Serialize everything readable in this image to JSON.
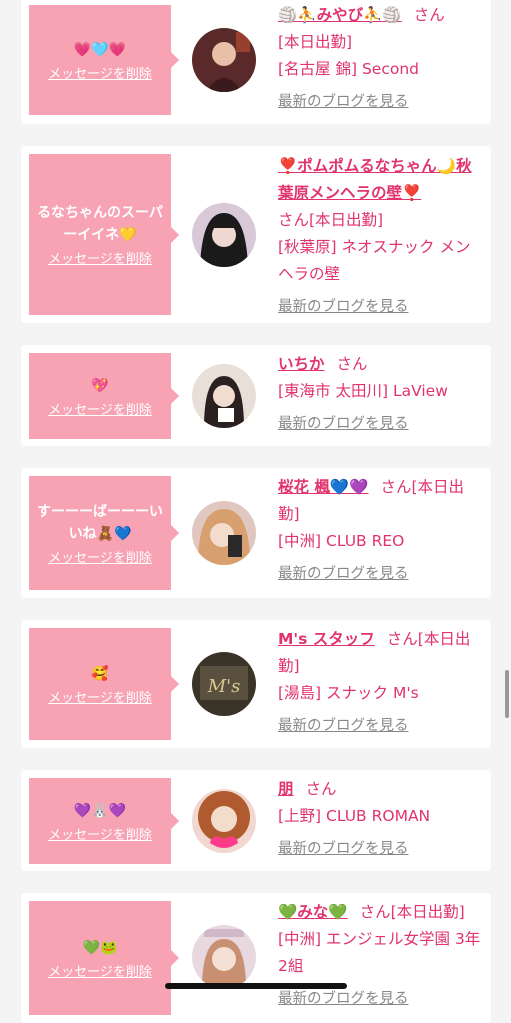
{
  "entries": [
    {
      "message": "💗🩵💗",
      "delete_label": "メッセージを削除",
      "name": "🏐⛹️みやび⛹️🏐",
      "san": "さん",
      "details": [
        "[本日出勤]",
        "[名古屋 錦] Second"
      ],
      "blog_label": "最新のブログを見る"
    },
    {
      "message": "るなちゃんのスーパーイイネ💛",
      "delete_label": "メッセージを削除",
      "name": "❣️ポムポムるなちゃん🌙秋葉原メンヘラの壁❣️",
      "san": "さん[本日出勤]",
      "details": [
        "[秋葉原] ネオスナック メンヘラの壁"
      ],
      "blog_label": "最新のブログを見る"
    },
    {
      "message": "💖",
      "delete_label": "メッセージを削除",
      "name": "いちか",
      "san": "さん",
      "details": [
        "[東海市 太田川] LaView"
      ],
      "blog_label": "最新のブログを見る"
    },
    {
      "message": "すーーーばーーーいいね🧸💙",
      "delete_label": "メッセージを削除",
      "name": "桜花 楓💙💜",
      "san": "さん[本日出勤]",
      "details": [
        "[中洲] CLUB REO"
      ],
      "blog_label": "最新のブログを見る"
    },
    {
      "message": "🥰",
      "delete_label": "メッセージを削除",
      "name": "M's スタッフ",
      "san": "さん[本日出勤]",
      "details": [
        "[湯島] スナック M's"
      ],
      "blog_label": "最新のブログを見る"
    },
    {
      "message": "💜🐰💜",
      "delete_label": "メッセージを削除",
      "name": "朋",
      "san": "さん",
      "details": [
        "[上野] CLUB ROMAN"
      ],
      "blog_label": "最新のブログを見る"
    },
    {
      "message": "💚🐸",
      "delete_label": "メッセージを削除",
      "name": "💚みな💚",
      "san": "さん[本日出勤]",
      "details": [
        "[中洲] エンジェル女学園 3年2組"
      ],
      "blog_label": "最新のブログを見る"
    }
  ],
  "colors": {
    "accent": "#e1336f",
    "bubble": "#f8a3b4",
    "link_gray": "#888888"
  }
}
